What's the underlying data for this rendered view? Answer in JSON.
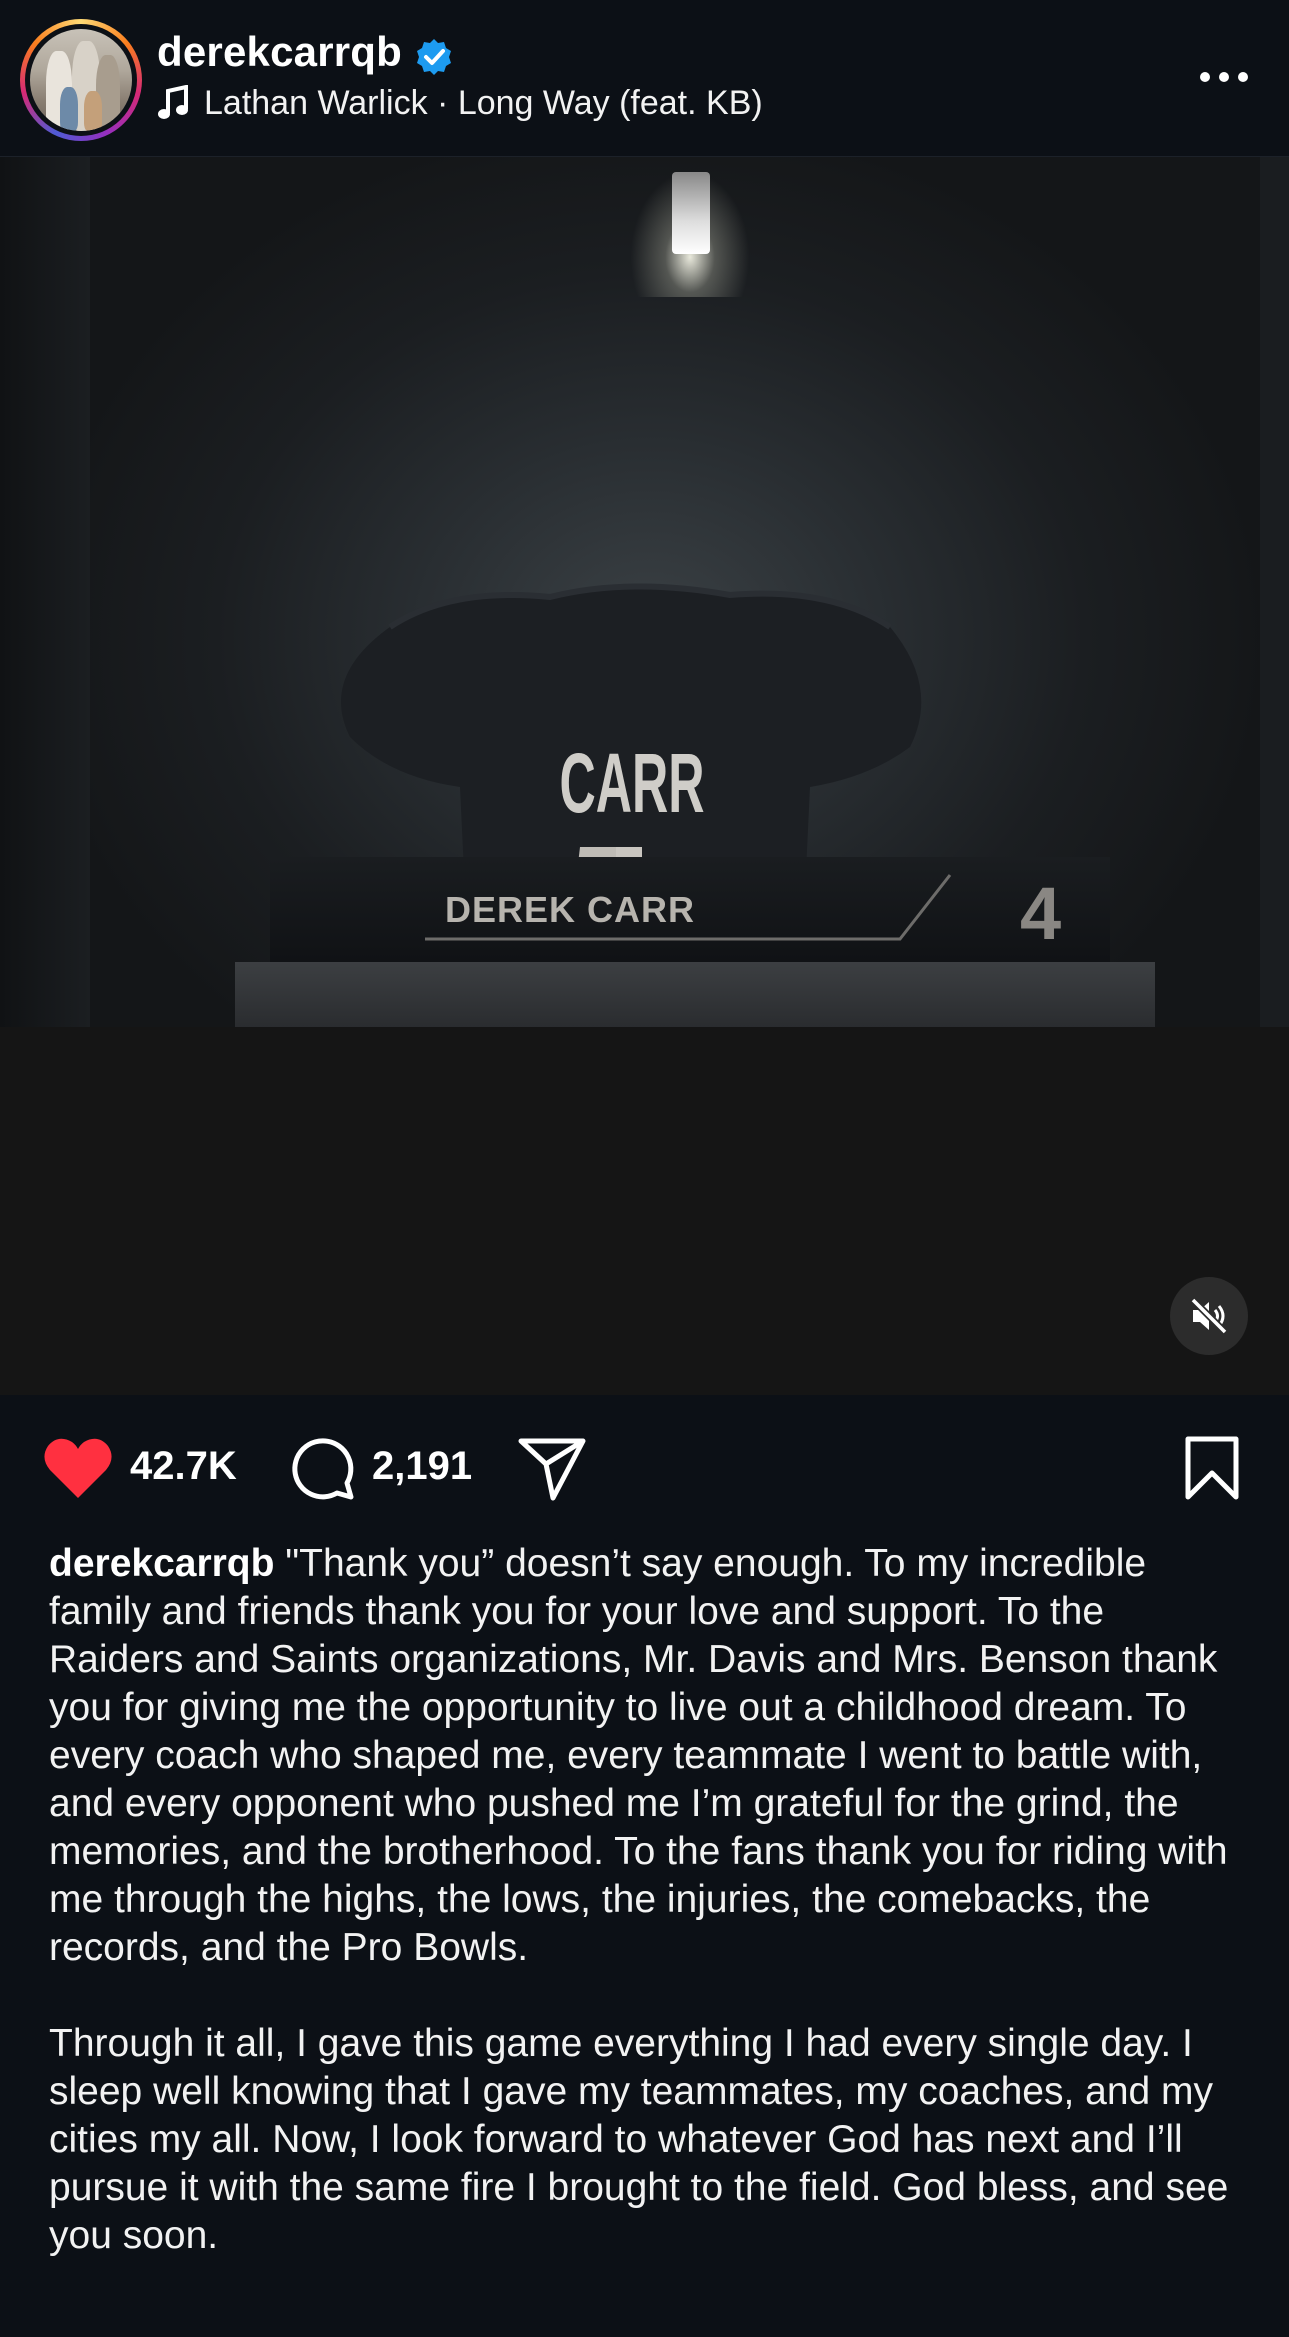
{
  "header": {
    "username": "derekcarrqb",
    "song": "Lathan Warlick · Long Way (feat. KB)"
  },
  "media": {
    "jersey_name": "CARR",
    "nameplate_name": "DEREK CARR",
    "nameplate_number": "4"
  },
  "actions": {
    "likes": "42.7K",
    "comments": "2,191"
  },
  "caption": {
    "username": "derekcarrqb",
    "paragraph1": " \"Thank you” doesn’t say enough. To my incredible family and friends thank you for your love and support. To the Raiders and Saints organizations, Mr. Davis and Mrs. Benson thank you for giving me the opportunity to live out a childhood dream. To every coach who shaped me, every teammate I went to battle with, and every opponent who pushed me I’m grateful for the grind, the memories, and the brotherhood. To the fans thank you for riding with me through the highs, the lows, the injuries, the comebacks, the records, and the Pro Bowls.",
    "paragraph2": "Through it all, I gave this game everything I had every single day. I sleep well knowing that I gave my teammates, my coaches, and my cities my all. Now, I look forward to whatever God has next and I’ll pursue it with the same fire I brought to the field. God bless, and see you soon."
  },
  "colors": {
    "background": "#0c1016",
    "like": "#ff3040",
    "verified": "#1d9bf0"
  },
  "icons": [
    "verified-badge-icon",
    "music-note-icon",
    "more-options-icon",
    "mute-icon",
    "heart-icon",
    "comment-icon",
    "share-icon",
    "bookmark-icon"
  ]
}
